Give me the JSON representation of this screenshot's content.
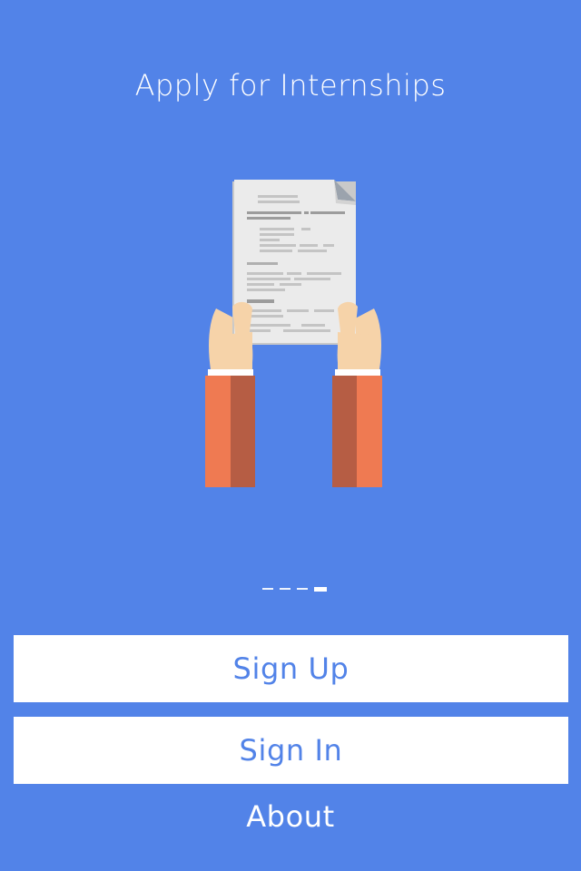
{
  "colors": {
    "background": "#5283E8",
    "button_bg": "#FFFFFF",
    "button_text": "#5283E8",
    "sleeve_light": "#EF7A52",
    "sleeve_dark": "#B65D44",
    "skin": "#F6D3A9",
    "paper": "#EBEBEB"
  },
  "header": {
    "title": "Apply for Internships"
  },
  "illustration": {
    "icon": "hands-holding-document-icon"
  },
  "pager": {
    "total_pages": 4,
    "current_page": 4
  },
  "actions": {
    "sign_up_label": "Sign Up",
    "sign_in_label": "Sign In",
    "about_label": "About"
  }
}
